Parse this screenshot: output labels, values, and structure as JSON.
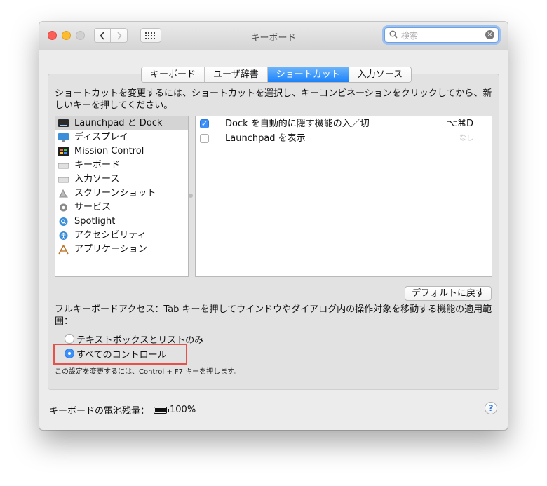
{
  "window": {
    "title": "キーボード"
  },
  "search": {
    "placeholder": "検索"
  },
  "tabs": [
    {
      "label": "キーボード",
      "active": false
    },
    {
      "label": "ユーザ辞書",
      "active": false
    },
    {
      "label": "ショートカット",
      "active": true
    },
    {
      "label": "入力ソース",
      "active": false
    }
  ],
  "description": "ショートカットを変更するには、ショートカットを選択し、キーコンビネーションをクリックしてから、新しいキーを押してください。",
  "categories": [
    {
      "label": "Launchpad と Dock",
      "icon": "launchpad-dock-icon",
      "selected": true
    },
    {
      "label": "ディスプレイ",
      "icon": "display-icon",
      "selected": false
    },
    {
      "label": "Mission Control",
      "icon": "mission-control-icon",
      "selected": false
    },
    {
      "label": "キーボード",
      "icon": "keyboard-icon",
      "selected": false
    },
    {
      "label": "入力ソース",
      "icon": "input-source-icon",
      "selected": false
    },
    {
      "label": "スクリーンショット",
      "icon": "screenshot-icon",
      "selected": false
    },
    {
      "label": "サービス",
      "icon": "gear-icon",
      "selected": false
    },
    {
      "label": "Spotlight",
      "icon": "spotlight-icon",
      "selected": false
    },
    {
      "label": "アクセシビリティ",
      "icon": "accessibility-icon",
      "selected": false
    },
    {
      "label": "アプリケーション",
      "icon": "applications-icon",
      "selected": false
    }
  ],
  "shortcuts": [
    {
      "label": "Dock を自動的に隠す機能の入／切",
      "key": "⌥⌘D",
      "checked": true
    },
    {
      "label": "Launchpad を表示",
      "key": "なし",
      "checked": false
    }
  ],
  "default_button": "デフォルトに戻す",
  "full_keyboard": {
    "label": "フルキーボードアクセス：Tab キーを押してウインドウやダイアログ内の操作対象を移動する機能の適用範囲：",
    "options": [
      {
        "label": "テキストボックスとリストのみ",
        "selected": false
      },
      {
        "label": "すべてのコントロール",
        "selected": true
      }
    ],
    "hint": "この設定を変更するには、Control + F7 キーを押します。"
  },
  "battery": {
    "label": "キーボードの電池残量：",
    "value": "100%"
  },
  "help": "?"
}
